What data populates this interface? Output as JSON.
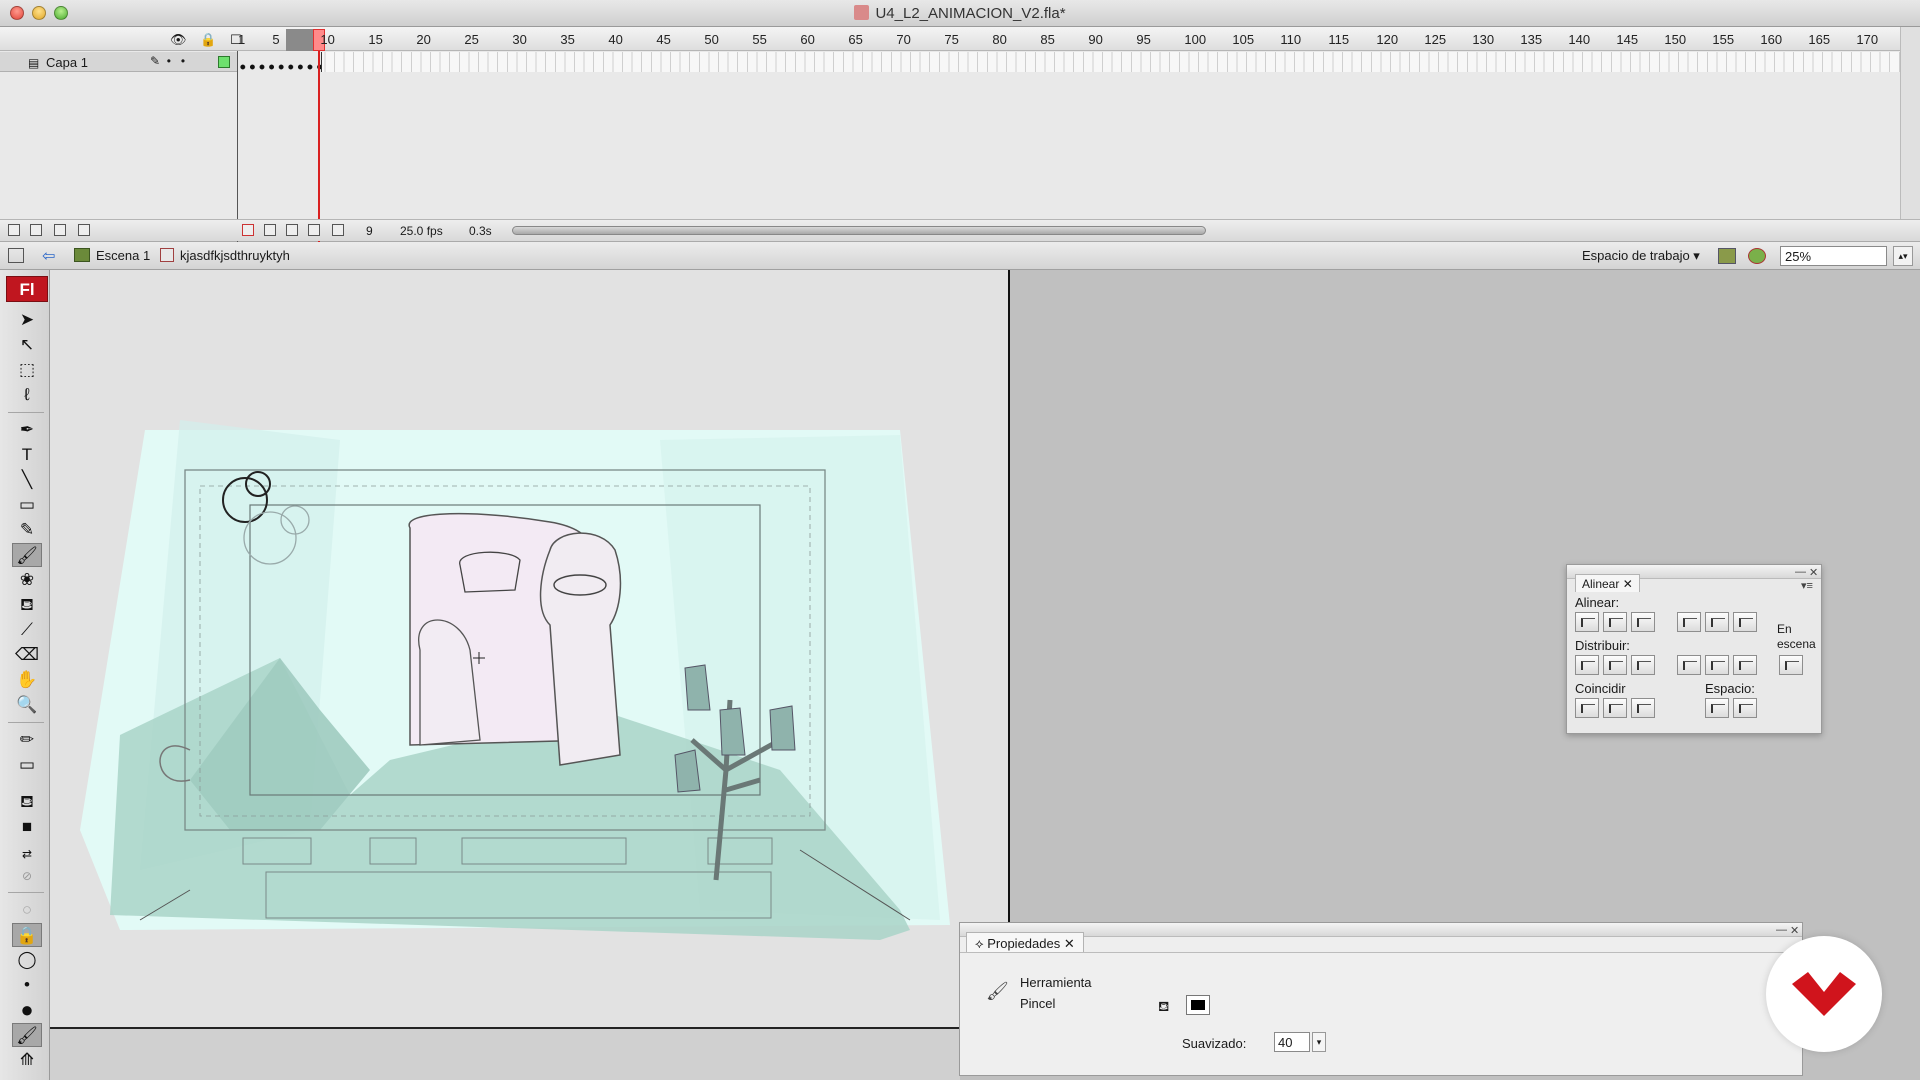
{
  "window": {
    "title": "U4_L2_ANIMACION_V2.fla*"
  },
  "timeline": {
    "ruler_ticks": [
      "1",
      "5",
      "10",
      "15",
      "20",
      "25",
      "30",
      "35",
      "40",
      "45",
      "50",
      "55",
      "60",
      "65",
      "70",
      "75",
      "80",
      "85",
      "90",
      "95",
      "100",
      "105",
      "110",
      "115",
      "120",
      "125",
      "130",
      "135",
      "140",
      "145",
      "150",
      "155",
      "160",
      "165",
      "170"
    ],
    "layer_name": "Capa 1",
    "current_frame": "9",
    "frame_rate": "25.0 fps",
    "elapsed_time": "0.3s"
  },
  "editbar": {
    "scene": "Escena 1",
    "symbol": "kjasdfkjsdthruyktyh",
    "workspace": "Espacio de trabajo ▾",
    "zoom": "25%"
  },
  "tools": {
    "logo": "Fl"
  },
  "align_panel": {
    "tab": "Alinear",
    "align_label": "Alinear:",
    "distribute_label": "Distribuir:",
    "match_label": "Coincidir",
    "space_label": "Espacio:",
    "stage_label_1": "En",
    "stage_label_2": "escena"
  },
  "properties_panel": {
    "tab": "Propiedades",
    "tool_type": "Herramienta",
    "tool_name": "Pincel",
    "smoothing_label": "Suavizado:",
    "smoothing_value": "40"
  },
  "colors": {
    "accent": "#c0161f",
    "playhead": "#d92020",
    "stage_bg": "#e0f8f5",
    "layer_color": "#6ee06e"
  }
}
